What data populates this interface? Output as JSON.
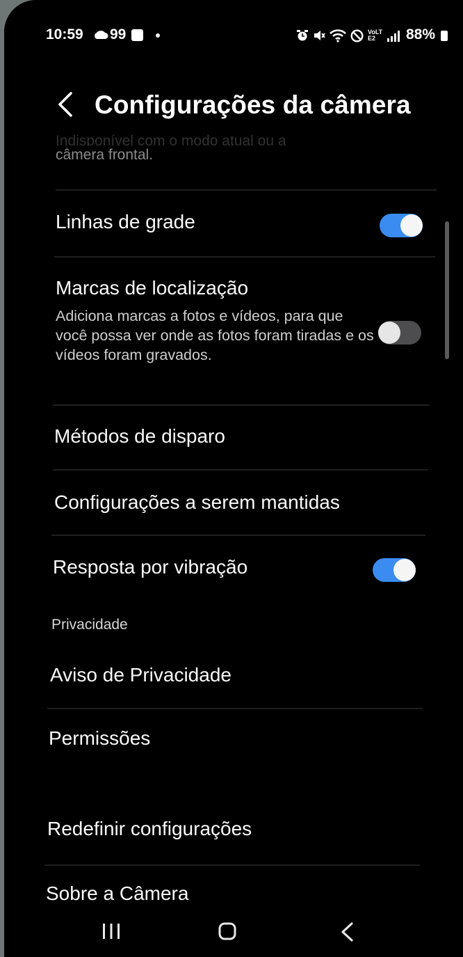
{
  "status_bar": {
    "time": "10:59",
    "notification_count": "99",
    "battery": "88%",
    "icons": [
      "cloud-icon",
      "gallery-icon",
      "dot-icon",
      "alarm-icon",
      "mute-icon",
      "wifi-icon",
      "do-not-disturb-icon",
      "volte-icon",
      "signal-icon",
      "battery-icon"
    ],
    "volte_label": "VoLTE2"
  },
  "header": {
    "title": "Configurações da câmera",
    "back_icon": "chevron-left-icon"
  },
  "list": {
    "partial_item_line1": "Indisponível com o modo atual ou a",
    "partial_item_line2": "câmera frontal.",
    "grid_lines": {
      "label": "Linhas de grade",
      "enabled": true
    },
    "location_tags": {
      "label": "Marcas de localização",
      "description": "Adiciona marcas a fotos e vídeos, para que você possa ver onde as fotos foram tiradas e os vídeos foram gravados.",
      "enabled": false
    },
    "shooting_methods": {
      "label": "Métodos de disparo"
    },
    "settings_to_keep": {
      "label": "Configurações a serem mantidas"
    },
    "vibration_feedback": {
      "label": "Resposta por vibração",
      "enabled": true
    },
    "privacy_section": {
      "header": "Privacidade"
    },
    "privacy_notice": {
      "label": "Aviso de Privacidade"
    },
    "permissions": {
      "label": "Permissões"
    },
    "reset_settings": {
      "label": "Redefinir configurações"
    },
    "about_camera": {
      "label": "Sobre a Câmera"
    }
  },
  "nav_bar": {
    "recents_icon": "recents-icon",
    "home_icon": "home-icon",
    "back_icon": "back-icon"
  },
  "colors": {
    "background": "#000000",
    "toggle_on": "#3a8cf0",
    "toggle_off": "#4d4d4f",
    "divider": "#1f1f1f"
  }
}
